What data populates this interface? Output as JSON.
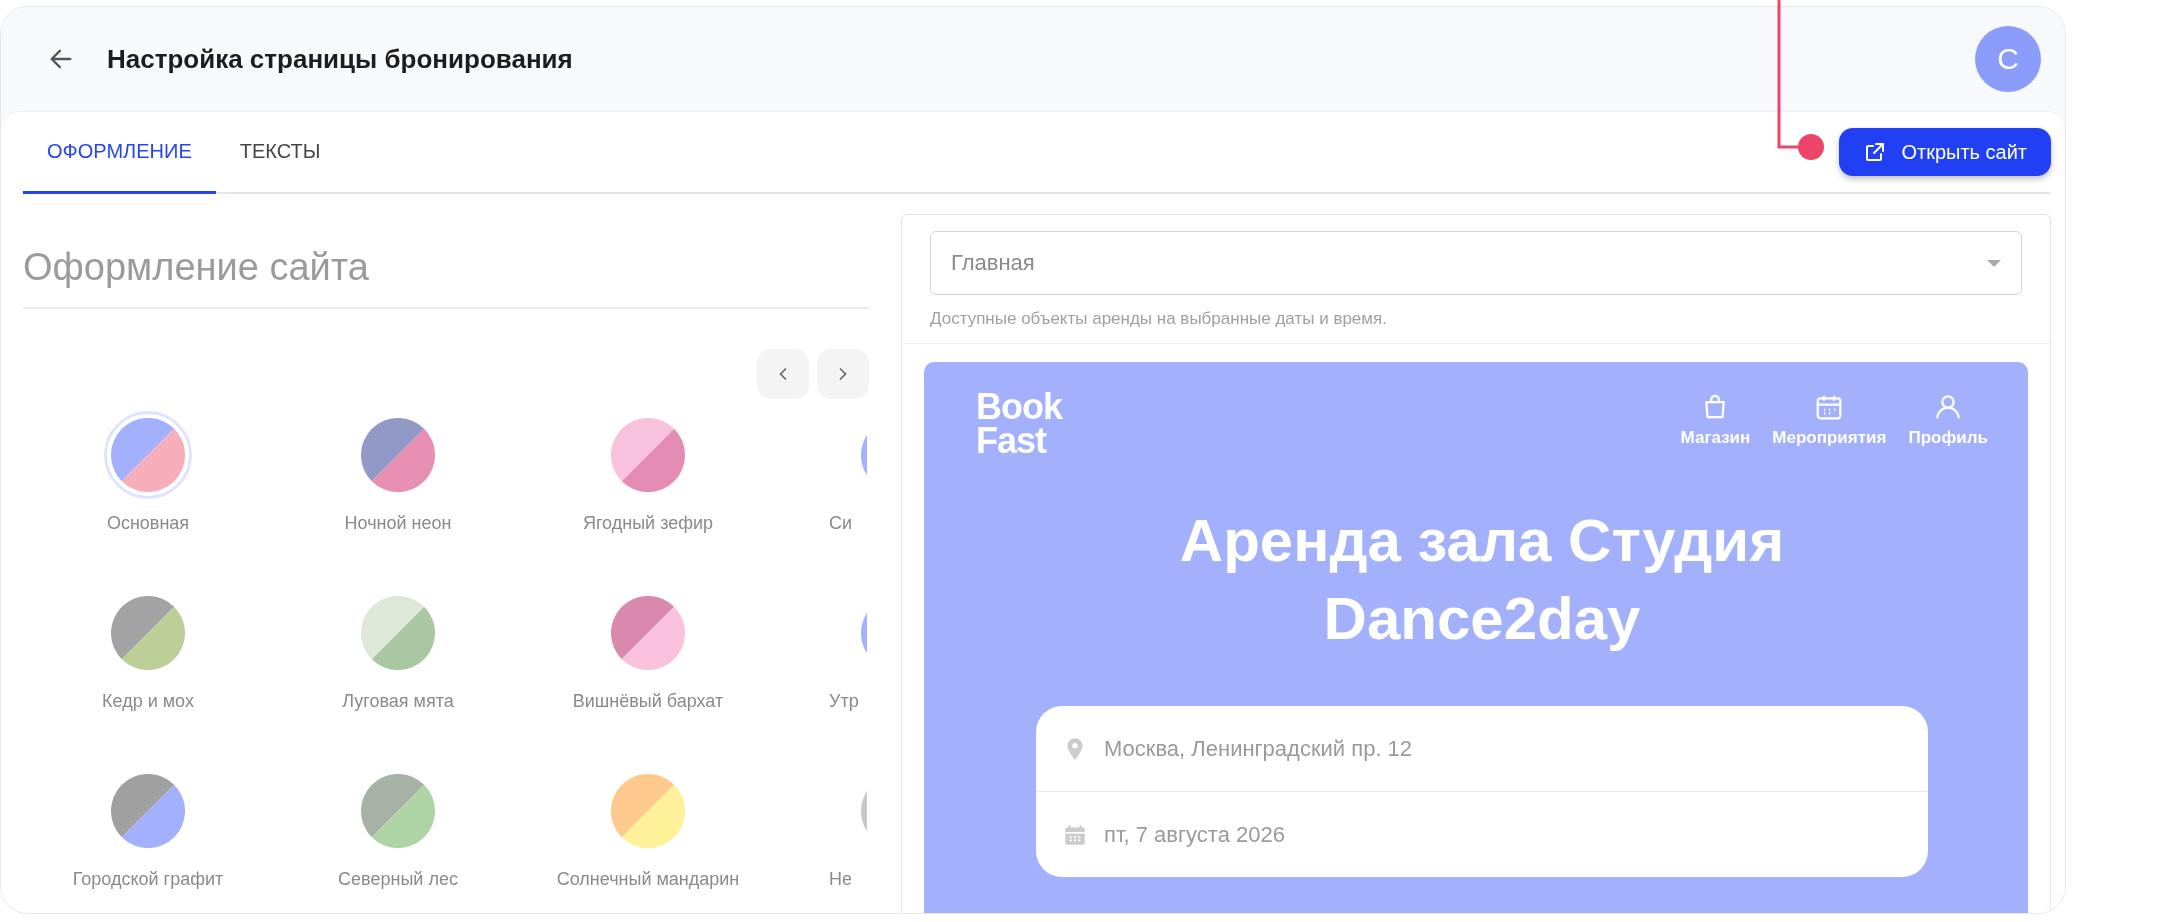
{
  "header": {
    "title": "Настройка страницы бронирования",
    "avatar": "С"
  },
  "tabs": [
    {
      "label": "ОФОРМЛЕНИЕ",
      "selected": true
    },
    {
      "label": "ТЕКСТЫ",
      "selected": false
    }
  ],
  "open_site_button": "Открыть сайт",
  "design": {
    "heading": "Оформление сайта",
    "themes": [
      {
        "name": "Основная",
        "halves": [
          {
            "color": "#a3b0fb"
          },
          {
            "color": "#f6aebb"
          }
        ],
        "selected": true
      },
      {
        "name": "Ночной неон",
        "halves": [
          {
            "color": "#9399c6"
          },
          {
            "color": "#e68fb3"
          }
        ],
        "selected": false
      },
      {
        "name": "Ягодный зефир",
        "halves": [
          {
            "color": "#f9c2dc"
          },
          {
            "color": "#e48cb4"
          }
        ],
        "selected": false
      },
      {
        "name": "Си",
        "halves": [
          {
            "color": "#a3b0fb"
          }
        ]
      },
      {
        "name": "Кедр и мох",
        "halves": [
          {
            "color": "#a3a3a3"
          },
          {
            "color": "#bccf97"
          }
        ],
        "selected": false
      },
      {
        "name": "Луговая мята",
        "halves": [
          {
            "color": "#dfe8d8"
          },
          {
            "color": "#a9c7a2"
          }
        ],
        "selected": false
      },
      {
        "name": "Вишнёвый бархат",
        "halves": [
          {
            "color": "#d989ac"
          },
          {
            "color": "#fbc2dd"
          }
        ],
        "selected": false
      },
      {
        "name": "Утр",
        "halves": [
          {
            "color": "#a3b0fb"
          }
        ]
      },
      {
        "name": "Городской графит",
        "halves": [
          {
            "color": "#a0a0a0"
          },
          {
            "color": "#a3b0fb"
          }
        ],
        "selected": false
      },
      {
        "name": "Северный лес",
        "halves": [
          {
            "color": "#a7b2a7"
          },
          {
            "color": "#aed3a5"
          }
        ],
        "selected": false
      },
      {
        "name": "Солнечный мандарин",
        "halves": [
          {
            "color": "#fec98d"
          },
          {
            "color": "#fff09a"
          }
        ],
        "selected": false
      },
      {
        "name": "Не",
        "halves": [
          {
            "color": "#c8c8c8"
          }
        ]
      }
    ]
  },
  "preview": {
    "page_select": {
      "value": "Главная"
    },
    "hint": "Доступные объекты аренды на выбранные даты и время.",
    "site": {
      "logo": [
        "Book",
        "Fast"
      ],
      "nav": [
        {
          "label": "Магазин",
          "kind": "bag"
        },
        {
          "label": "Мероприятия",
          "kind": "calendar"
        },
        {
          "label": "Профиль",
          "kind": "user"
        }
      ],
      "title": "Аренда зала Студия Dance2day",
      "booking_fields": [
        {
          "kind": "location",
          "text": "Москва, Ленинградский пр. 12"
        },
        {
          "kind": "date",
          "text": "пт, 7 августа 2026"
        }
      ]
    }
  }
}
